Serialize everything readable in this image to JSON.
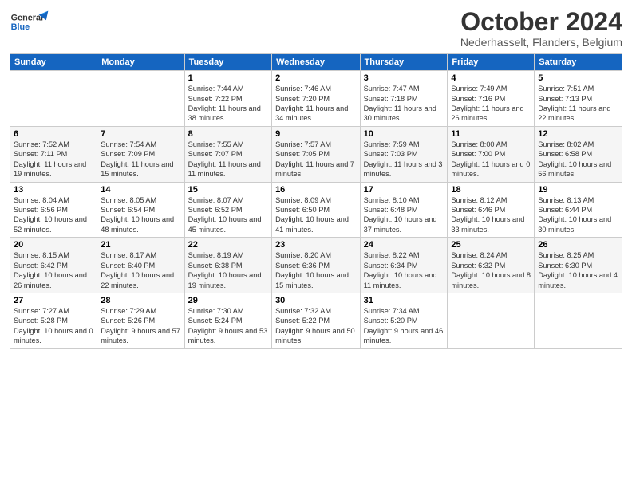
{
  "header": {
    "logo_general": "General",
    "logo_blue": "Blue",
    "month_title": "October 2024",
    "location": "Nederhasselt, Flanders, Belgium"
  },
  "days_of_week": [
    "Sunday",
    "Monday",
    "Tuesday",
    "Wednesday",
    "Thursday",
    "Friday",
    "Saturday"
  ],
  "weeks": [
    [
      {
        "day": "",
        "info": ""
      },
      {
        "day": "",
        "info": ""
      },
      {
        "day": "1",
        "info": "Sunrise: 7:44 AM\nSunset: 7:22 PM\nDaylight: 11 hours and 38 minutes."
      },
      {
        "day": "2",
        "info": "Sunrise: 7:46 AM\nSunset: 7:20 PM\nDaylight: 11 hours and 34 minutes."
      },
      {
        "day": "3",
        "info": "Sunrise: 7:47 AM\nSunset: 7:18 PM\nDaylight: 11 hours and 30 minutes."
      },
      {
        "day": "4",
        "info": "Sunrise: 7:49 AM\nSunset: 7:16 PM\nDaylight: 11 hours and 26 minutes."
      },
      {
        "day": "5",
        "info": "Sunrise: 7:51 AM\nSunset: 7:13 PM\nDaylight: 11 hours and 22 minutes."
      }
    ],
    [
      {
        "day": "6",
        "info": "Sunrise: 7:52 AM\nSunset: 7:11 PM\nDaylight: 11 hours and 19 minutes."
      },
      {
        "day": "7",
        "info": "Sunrise: 7:54 AM\nSunset: 7:09 PM\nDaylight: 11 hours and 15 minutes."
      },
      {
        "day": "8",
        "info": "Sunrise: 7:55 AM\nSunset: 7:07 PM\nDaylight: 11 hours and 11 minutes."
      },
      {
        "day": "9",
        "info": "Sunrise: 7:57 AM\nSunset: 7:05 PM\nDaylight: 11 hours and 7 minutes."
      },
      {
        "day": "10",
        "info": "Sunrise: 7:59 AM\nSunset: 7:03 PM\nDaylight: 11 hours and 3 minutes."
      },
      {
        "day": "11",
        "info": "Sunrise: 8:00 AM\nSunset: 7:00 PM\nDaylight: 11 hours and 0 minutes."
      },
      {
        "day": "12",
        "info": "Sunrise: 8:02 AM\nSunset: 6:58 PM\nDaylight: 10 hours and 56 minutes."
      }
    ],
    [
      {
        "day": "13",
        "info": "Sunrise: 8:04 AM\nSunset: 6:56 PM\nDaylight: 10 hours and 52 minutes."
      },
      {
        "day": "14",
        "info": "Sunrise: 8:05 AM\nSunset: 6:54 PM\nDaylight: 10 hours and 48 minutes."
      },
      {
        "day": "15",
        "info": "Sunrise: 8:07 AM\nSunset: 6:52 PM\nDaylight: 10 hours and 45 minutes."
      },
      {
        "day": "16",
        "info": "Sunrise: 8:09 AM\nSunset: 6:50 PM\nDaylight: 10 hours and 41 minutes."
      },
      {
        "day": "17",
        "info": "Sunrise: 8:10 AM\nSunset: 6:48 PM\nDaylight: 10 hours and 37 minutes."
      },
      {
        "day": "18",
        "info": "Sunrise: 8:12 AM\nSunset: 6:46 PM\nDaylight: 10 hours and 33 minutes."
      },
      {
        "day": "19",
        "info": "Sunrise: 8:13 AM\nSunset: 6:44 PM\nDaylight: 10 hours and 30 minutes."
      }
    ],
    [
      {
        "day": "20",
        "info": "Sunrise: 8:15 AM\nSunset: 6:42 PM\nDaylight: 10 hours and 26 minutes."
      },
      {
        "day": "21",
        "info": "Sunrise: 8:17 AM\nSunset: 6:40 PM\nDaylight: 10 hours and 22 minutes."
      },
      {
        "day": "22",
        "info": "Sunrise: 8:19 AM\nSunset: 6:38 PM\nDaylight: 10 hours and 19 minutes."
      },
      {
        "day": "23",
        "info": "Sunrise: 8:20 AM\nSunset: 6:36 PM\nDaylight: 10 hours and 15 minutes."
      },
      {
        "day": "24",
        "info": "Sunrise: 8:22 AM\nSunset: 6:34 PM\nDaylight: 10 hours and 11 minutes."
      },
      {
        "day": "25",
        "info": "Sunrise: 8:24 AM\nSunset: 6:32 PM\nDaylight: 10 hours and 8 minutes."
      },
      {
        "day": "26",
        "info": "Sunrise: 8:25 AM\nSunset: 6:30 PM\nDaylight: 10 hours and 4 minutes."
      }
    ],
    [
      {
        "day": "27",
        "info": "Sunrise: 7:27 AM\nSunset: 5:28 PM\nDaylight: 10 hours and 0 minutes."
      },
      {
        "day": "28",
        "info": "Sunrise: 7:29 AM\nSunset: 5:26 PM\nDaylight: 9 hours and 57 minutes."
      },
      {
        "day": "29",
        "info": "Sunrise: 7:30 AM\nSunset: 5:24 PM\nDaylight: 9 hours and 53 minutes."
      },
      {
        "day": "30",
        "info": "Sunrise: 7:32 AM\nSunset: 5:22 PM\nDaylight: 9 hours and 50 minutes."
      },
      {
        "day": "31",
        "info": "Sunrise: 7:34 AM\nSunset: 5:20 PM\nDaylight: 9 hours and 46 minutes."
      },
      {
        "day": "",
        "info": ""
      },
      {
        "day": "",
        "info": ""
      }
    ]
  ]
}
